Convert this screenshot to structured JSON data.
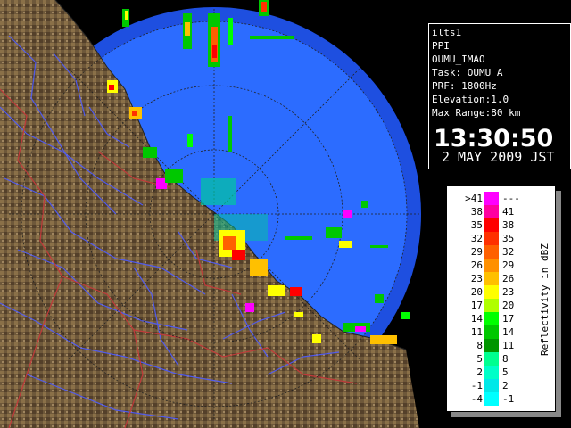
{
  "info": {
    "site": "ilts1",
    "product": "PPI",
    "station": "OUMU_IMAO",
    "task": "Task: OUMU_A",
    "prf": "PRF: 1800Hz",
    "elevation": "Elevation:1.0",
    "max_range": "Max Range:80 km",
    "time": "13:30:50",
    "date": "2 MAY 2009 JST"
  },
  "legend": {
    "title": "Reflectivity in dBZ",
    "rows": [
      {
        "lo": ">41",
        "hi": "---",
        "color": "#ff00ff"
      },
      {
        "lo": "38",
        "hi": "41",
        "color": "#ff00a0"
      },
      {
        "lo": "35",
        "hi": "38",
        "color": "#ff0000"
      },
      {
        "lo": "32",
        "hi": "35",
        "color": "#ff3000"
      },
      {
        "lo": "29",
        "hi": "32",
        "color": "#ff6000"
      },
      {
        "lo": "26",
        "hi": "29",
        "color": "#ff9000"
      },
      {
        "lo": "23",
        "hi": "26",
        "color": "#ffc000"
      },
      {
        "lo": "20",
        "hi": "23",
        "color": "#ffff00"
      },
      {
        "lo": "17",
        "hi": "20",
        "color": "#b0ff00"
      },
      {
        "lo": "14",
        "hi": "17",
        "color": "#00ff00"
      },
      {
        "lo": "11",
        "hi": "14",
        "color": "#00c800"
      },
      {
        "lo": "8",
        "hi": "11",
        "color": "#009600"
      },
      {
        "lo": "5",
        "hi": "8",
        "color": "#00ff90"
      },
      {
        "lo": "2",
        "hi": "5",
        "color": "#00ffc8"
      },
      {
        "lo": "-1",
        "hi": "2",
        "color": "#00e8e8"
      },
      {
        "lo": "-4",
        "hi": "-1",
        "color": "#00ffff"
      }
    ]
  },
  "colors": {
    "sea_outer": "#1e50e6",
    "sea_inner": "#2a70ff",
    "land": "#6b5536",
    "rivers": "#4a5aff",
    "borders": "#c04040"
  }
}
